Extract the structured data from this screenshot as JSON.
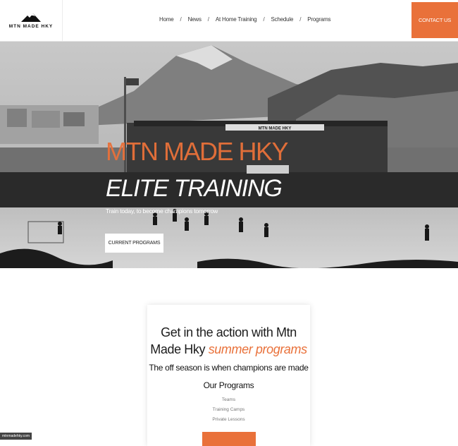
{
  "header": {
    "logo_text": "MTN MADE HKY",
    "nav": [
      {
        "label": "Home"
      },
      {
        "label": "News"
      },
      {
        "label": "At Home Training"
      },
      {
        "label": "Schedule"
      },
      {
        "label": "Programs"
      }
    ],
    "nav_separator": "/",
    "contact_label": "CONTACT US"
  },
  "hero": {
    "title": "MTN MADE HKY",
    "subtitle": "ELITE TRAINING",
    "tagline": "Train today, to become champions tomorrow",
    "button_label": "CURRENT PROGRAMS",
    "stadium_sign": "MTN MADE HKY"
  },
  "card": {
    "heading_main": "Get in the action with Mtn Made Hky",
    "heading_accent": "summer programs",
    "subheading": "The off season is when champions are made",
    "programs_title": "Our Programs",
    "programs": [
      "Teams",
      "Training Camps",
      "Private Lessons"
    ]
  },
  "footer": {
    "domain_badge": "mtnmadehky.com"
  },
  "colors": {
    "accent": "#e9713a",
    "text": "#1c1c1c"
  }
}
